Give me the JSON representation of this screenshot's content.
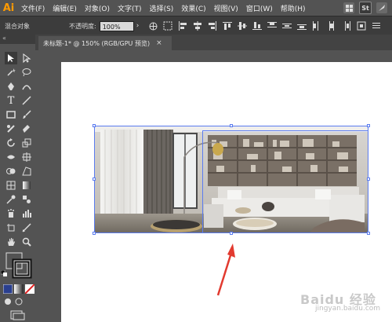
{
  "app": {
    "logo": "Ai"
  },
  "menu": [
    "文件(F)",
    "编辑(E)",
    "对象(O)",
    "文字(T)",
    "选择(S)",
    "效果(C)",
    "视图(V)",
    "窗口(W)",
    "帮助(H)"
  ],
  "menu_right": {
    "st_label": "St"
  },
  "controlbar": {
    "object_label": "混合对象",
    "opacity_label": "不透明度:",
    "opacity_value": "100%"
  },
  "document": {
    "tab_title": "未标题-1* @ 150% (RGB/GPU 预览)",
    "close": "×"
  },
  "left_panel": {
    "collapse": "«"
  },
  "watermark": {
    "text": "Baidu 经验",
    "sub": "jingyan.baidu.com"
  },
  "colors": {
    "selection": "#5b7cf0",
    "arrow": "#e23a2f",
    "accent_logo": "#ff9a00"
  }
}
